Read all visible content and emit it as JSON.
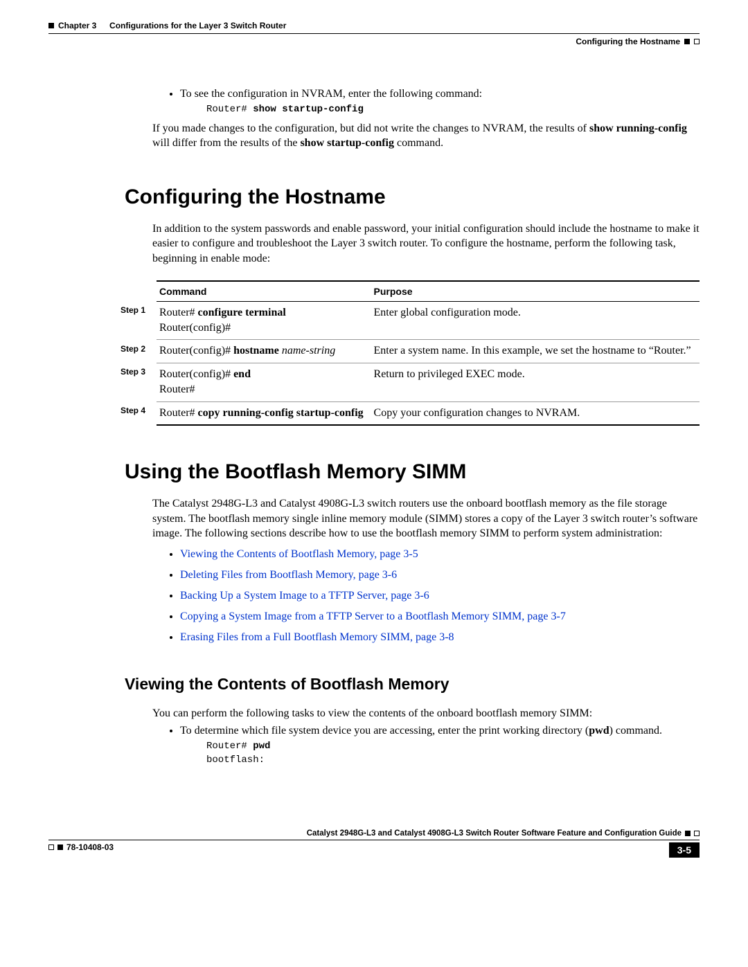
{
  "header": {
    "chapter": "Chapter 3",
    "title": "Configurations for the Layer 3 Switch Router",
    "section": "Configuring the Hostname"
  },
  "intro": {
    "bullet1": "To see the configuration in NVRAM, enter the following command:",
    "code_prefix": "Router# ",
    "code_cmd": "show startup-config",
    "para_pre": "If you made changes to the configuration, but did not write the changes to NVRAM, the results of ",
    "para_bold1": "show running-config",
    "para_mid": " will differ from the results of the ",
    "para_bold2": "show startup-config",
    "para_end": " command."
  },
  "hostname": {
    "heading": "Configuring the Hostname",
    "para": "In addition to the system passwords and enable password, your initial configuration should include the hostname to make it easier to configure and troubleshoot the Layer 3 switch router. To configure the hostname, perform the following task, beginning in enable mode:",
    "th_command": "Command",
    "th_purpose": "Purpose",
    "rows": [
      {
        "step": "Step 1",
        "cmd_pre": "Router# ",
        "cmd_bold": "configure terminal",
        "cmd_it": "",
        "cmd_line2": "Router(config)#",
        "purpose": "Enter global configuration mode."
      },
      {
        "step": "Step 2",
        "cmd_pre": "Router(config)# ",
        "cmd_bold": "hostname",
        "cmd_it": " name-string",
        "cmd_line2": "",
        "purpose": "Enter a system name. In this example, we set the hostname to “Router.”"
      },
      {
        "step": "Step 3",
        "cmd_pre": "Router(config)# ",
        "cmd_bold": "end",
        "cmd_it": "",
        "cmd_line2": "Router#",
        "purpose": "Return to privileged EXEC mode."
      },
      {
        "step": "Step 4",
        "cmd_pre": "Router# ",
        "cmd_bold": "copy running-config startup-config",
        "cmd_it": "",
        "cmd_line2": "",
        "purpose": "Copy your configuration changes to NVRAM."
      }
    ]
  },
  "bootflash": {
    "heading": "Using the Bootflash Memory SIMM",
    "para": "The Catalyst 2948G-L3 and Catalyst 4908G-L3 switch routers use the onboard bootflash memory as the file storage system. The bootflash memory single inline memory module (SIMM) stores a copy of the Layer 3 switch router’s software image. The following sections describe how to use the bootflash memory SIMM to perform system administration:",
    "links": [
      "Viewing the Contents of Bootflash Memory, page 3-5",
      "Deleting Files from Bootflash Memory, page 3-6",
      "Backing Up a System Image to a TFTP Server, page 3-6",
      "Copying a System Image from a TFTP Server to a Bootflash Memory SIMM, page 3-7",
      "Erasing Files from a Full Bootflash Memory SIMM, page 3-8"
    ],
    "sub_heading": "Viewing the Contents of Bootflash Memory",
    "sub_para": "You can perform the following tasks to view the contents of the onboard bootflash memory SIMM:",
    "sub_bullet_pre": "To determine which file system device you are accessing, enter the print working directory (",
    "sub_bullet_bold": "pwd",
    "sub_bullet_post": ") command.",
    "code_prefix": "Router# ",
    "code_cmd": "pwd",
    "code_out": "bootflash:"
  },
  "footer": {
    "guide_title": "Catalyst 2948G-L3 and Catalyst 4908G-L3 Switch Router Software Feature and Configuration Guide",
    "doc_num": "78-10408-03",
    "page_num": "3-5"
  }
}
